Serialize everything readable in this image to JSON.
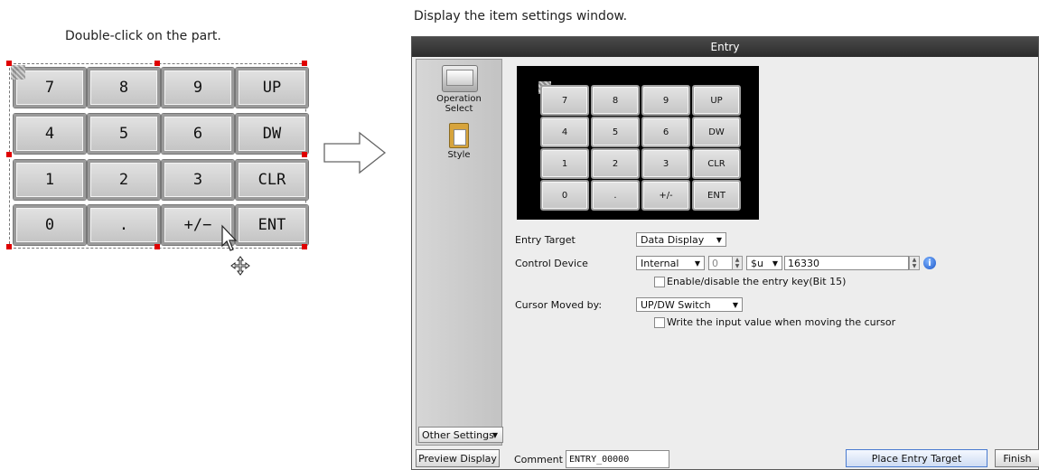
{
  "captions": {
    "left": "Double-click on the part.",
    "right": "Display the item settings window."
  },
  "keypad": {
    "rows": [
      [
        "7",
        "8",
        "9",
        "UP"
      ],
      [
        "4",
        "5",
        "6",
        "DW"
      ],
      [
        "1",
        "2",
        "3",
        "CLR"
      ],
      [
        "0",
        ".",
        "+/−",
        "ENT"
      ]
    ]
  },
  "window": {
    "title": "Entry",
    "sidebar": {
      "items": [
        "Operation Select",
        "Style"
      ],
      "other_settings": "Other Settings"
    },
    "preview_keypad": [
      [
        "7",
        "8",
        "9",
        "UP"
      ],
      [
        "4",
        "5",
        "6",
        "DW"
      ],
      [
        "1",
        "2",
        "3",
        "CLR"
      ],
      [
        "0",
        ".",
        "+/-",
        "ENT"
      ]
    ],
    "form": {
      "entry_target_label": "Entry Target",
      "entry_target_value": "Data Display",
      "control_device_label": "Control Device",
      "control_device_type": "Internal",
      "control_device_num": "0",
      "control_device_reg": "$u",
      "control_device_addr": "16330",
      "enable_checkbox_label": "Enable/disable the entry key(Bit 15)",
      "cursor_label": "Cursor Moved by:",
      "cursor_value": "UP/DW Switch",
      "write_checkbox_label": "Write the input value when moving the cursor"
    },
    "bottom": {
      "preview_button": "Preview Display",
      "comment_label": "Comment",
      "comment_value": "ENTRY_00000",
      "place_button": "Place Entry Target",
      "finish_button": "Finish"
    }
  }
}
